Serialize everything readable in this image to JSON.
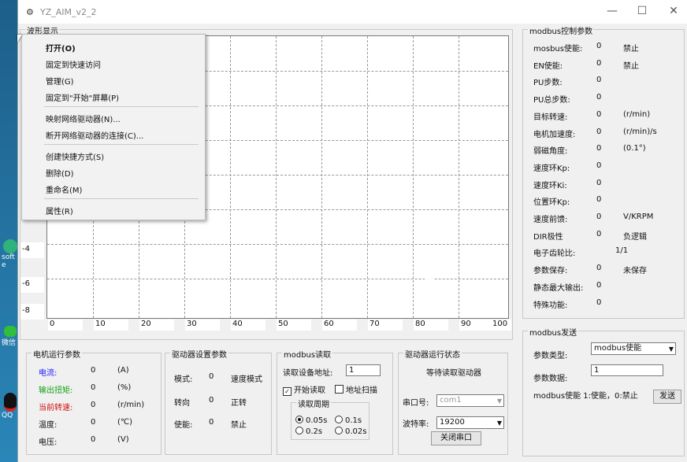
{
  "window": {
    "title": "YZ_AIM_v2_2"
  },
  "desktop": {
    "labels": [
      "soft",
      "e",
      "微信",
      "QQ"
    ]
  },
  "waveform": {
    "group_title": "波形显示",
    "y_ticks": [
      "-4",
      "-6",
      "-8"
    ],
    "x_ticks": [
      "0",
      "10",
      "20",
      "30",
      "40",
      "50",
      "60",
      "70",
      "80",
      "90",
      "100"
    ]
  },
  "context_menu": {
    "items": [
      "打开(O)",
      "固定到快速访问",
      "管理(G)",
      "固定到\"开始\"屏幕(P)",
      "映射网络驱动器(N)...",
      "断开网络驱动器的连接(C)...",
      "创建快捷方式(S)",
      "删除(D)",
      "重命名(M)",
      "属性(R)"
    ]
  },
  "motor": {
    "title": "电机运行参数",
    "rows": [
      {
        "label": "电流:",
        "value": "0",
        "unit": "(A)"
      },
      {
        "label": "输出扭矩:",
        "value": "0",
        "unit": "(%)"
      },
      {
        "label": "当前转速:",
        "value": "0",
        "unit": "(r/min)"
      },
      {
        "label": "温度:",
        "value": "0",
        "unit": "(℃)"
      },
      {
        "label": "电压:",
        "value": "0",
        "unit": "(V)"
      }
    ]
  },
  "driver_settings": {
    "title": "驱动器设置参数",
    "rows": [
      {
        "label": "模式:",
        "value": "0",
        "text": "速度模式"
      },
      {
        "label": "转向",
        "value": "0",
        "text": "正转"
      },
      {
        "label": "使能:",
        "value": "0",
        "text": "禁止"
      }
    ]
  },
  "modbus_read": {
    "title": "modbus读取",
    "addr_label": "读取设备地址:",
    "addr_value": "1",
    "start_label": "开始读取",
    "scan_label": "地址扫描",
    "period_title": "读取周期",
    "periods": [
      "0.05s",
      "0.1s",
      "0.2s",
      "0.02s"
    ],
    "selected_period": "0.05s"
  },
  "driver_status": {
    "title": "驱动器运行状态",
    "status_text": "等待读取驱动器",
    "port_label": "串口号:",
    "port_value": "com1",
    "baud_label": "波特率:",
    "baud_value": "19200",
    "close_port": "关闭串口"
  },
  "modbus_params": {
    "title": "modbus控制参数",
    "rows": [
      {
        "label": "mosbus使能:",
        "value": "0",
        "extra": "禁止"
      },
      {
        "label": "EN使能:",
        "value": "0",
        "extra": "禁止"
      },
      {
        "label": "PU步数:",
        "value": "0",
        "extra": ""
      },
      {
        "label": "PU总步数:",
        "value": "0",
        "extra": ""
      },
      {
        "label": "目标转速:",
        "value": "0",
        "extra": "(r/min)"
      },
      {
        "label": "电机加速度:",
        "value": "0",
        "extra": "(r/min)/s"
      },
      {
        "label": "弱磁角度:",
        "value": "0",
        "extra": "(0.1°)"
      },
      {
        "label": "速度环Kp:",
        "value": "0",
        "extra": ""
      },
      {
        "label": "速度环Ki:",
        "value": "0",
        "extra": ""
      },
      {
        "label": "位置环Kp:",
        "value": "0",
        "extra": ""
      },
      {
        "label": "速度前馈:",
        "value": "0",
        "extra": "V/KRPM"
      },
      {
        "label": "DIR极性",
        "value": "0",
        "extra": "负逻辑"
      },
      {
        "label": "电子齿轮比:",
        "value": "",
        "extra": "1/1"
      },
      {
        "label": "参数保存:",
        "value": "0",
        "extra": "未保存"
      },
      {
        "label": "静态最大输出:",
        "value": "0",
        "extra": ""
      },
      {
        "label": "特殊功能:",
        "value": "0",
        "extra": ""
      }
    ]
  },
  "modbus_send": {
    "title": "modbus发送",
    "type_label": "参数类型:",
    "type_value": "modbus使能",
    "data_label": "参数数据:",
    "data_value": "1",
    "hint": "modbus使能 1:使能，0:禁止",
    "send": "发送"
  }
}
